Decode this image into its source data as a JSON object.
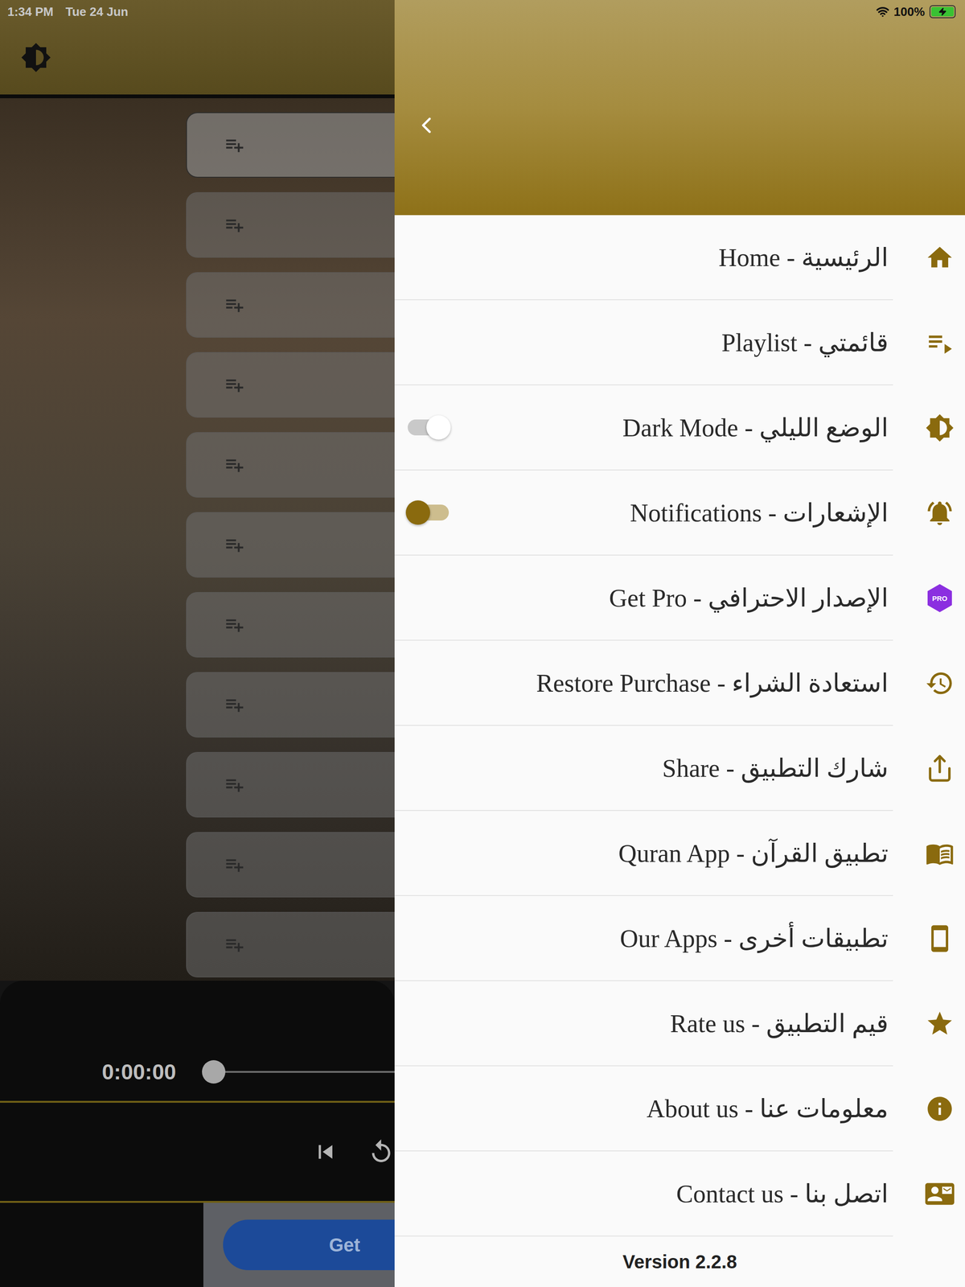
{
  "status_bar": {
    "time": "1:34 PM",
    "date": "Tue 24 Jun",
    "battery": "100%",
    "battery_level": 1,
    "charging": true
  },
  "background": {
    "rows": [
      {
        "selected": true
      },
      {
        "selected": false
      },
      {
        "selected": false
      },
      {
        "selected": false
      },
      {
        "selected": false
      },
      {
        "selected": false
      },
      {
        "selected": false
      },
      {
        "selected": false
      },
      {
        "selected": false
      },
      {
        "selected": false
      },
      {
        "selected": false
      }
    ],
    "player": {
      "elapsed": "0:00:00",
      "level": 0
    },
    "get_button": "Get"
  },
  "drawer": {
    "items": [
      {
        "label": "Home - الرئيسية",
        "kind": "link"
      },
      {
        "label": "Playlist - قائمتي",
        "kind": "link"
      },
      {
        "label": "Dark Mode - الوضع الليلي",
        "kind": "toggle",
        "on": false
      },
      {
        "label": "Notifications - الإشعارات",
        "kind": "toggle",
        "on": true
      },
      {
        "label": "Get Pro - الإصدار الاحترافي",
        "kind": "badge",
        "badge": "PRO"
      },
      {
        "label": "Restore Purchase - استعادة الشراء",
        "kind": "link"
      },
      {
        "label": "Share - شارك التطبيق",
        "kind": "link"
      },
      {
        "label": "Quran App - تطبيق القرآن",
        "kind": "link"
      },
      {
        "label": "Our Apps - تطبيقات أخرى",
        "kind": "link"
      },
      {
        "label": "Rate us - قيم التطبيق",
        "kind": "link"
      },
      {
        "label": "About us - معلومات عنا",
        "kind": "link"
      },
      {
        "label": "Contact us - اتصل بنا",
        "kind": "link"
      }
    ],
    "version": "Version 2.2.8"
  }
}
